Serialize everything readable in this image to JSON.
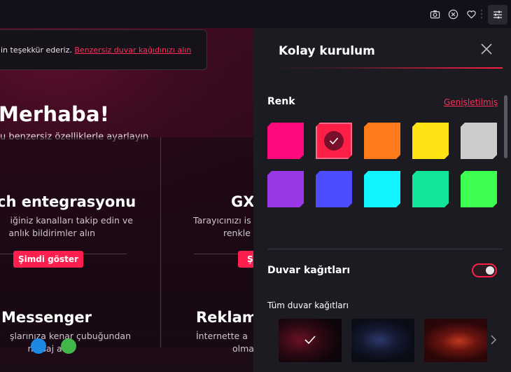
{
  "toolbar": {
    "icons": [
      "camera-icon",
      "close-circle-icon",
      "heart-icon",
      "more-icon",
      "sliders-icon"
    ]
  },
  "page": {
    "notice_text": "in teşekkür ederiz. ",
    "notice_link": "Benzersiz duvar kağıdınızı alın",
    "greeting": "Merhaba!",
    "greeting_sub": "u benzersiz özelliklerle ayarlayın",
    "cards": [
      {
        "title": "ch entegrasyonu",
        "desc1": "iğiniz kanalları takip edin ve",
        "desc2": "anlık bildirimler alın",
        "button": "Şimdi göster"
      },
      {
        "title": "GX",
        "desc1": "Tarayıcınızı is",
        "desc2": "renkle",
        "button": "Ş"
      },
      {
        "title": "Messenger",
        "desc1": "şlarınıza kenar çubuğundan",
        "desc2": "mesaj atın"
      },
      {
        "title": "Reklam",
        "desc1": "İnternette a",
        "desc2": "olma"
      }
    ]
  },
  "panel": {
    "title": "Kolay kurulum",
    "color_section": "Renk",
    "expand_link": "Genişletilmiş",
    "swatches": [
      {
        "color": "#ff0a7c",
        "selected": false
      },
      {
        "color": "#ff1f46",
        "selected": true
      },
      {
        "color": "#ff7a1a",
        "selected": false
      },
      {
        "color": "#ffe312",
        "selected": false
      },
      {
        "color": "#cccccc",
        "selected": false
      },
      {
        "color": "#9a37e6",
        "selected": false
      },
      {
        "color": "#4d4dff",
        "selected": false
      },
      {
        "color": "#12f5ff",
        "selected": false
      },
      {
        "color": "#12e69b",
        "selected": false
      },
      {
        "color": "#3dff4f",
        "selected": false
      }
    ],
    "wallpapers_section": "Duvar kağıtları",
    "wallpapers_toggle_on": true,
    "all_wallpapers": "Tüm duvar kağıtları"
  }
}
